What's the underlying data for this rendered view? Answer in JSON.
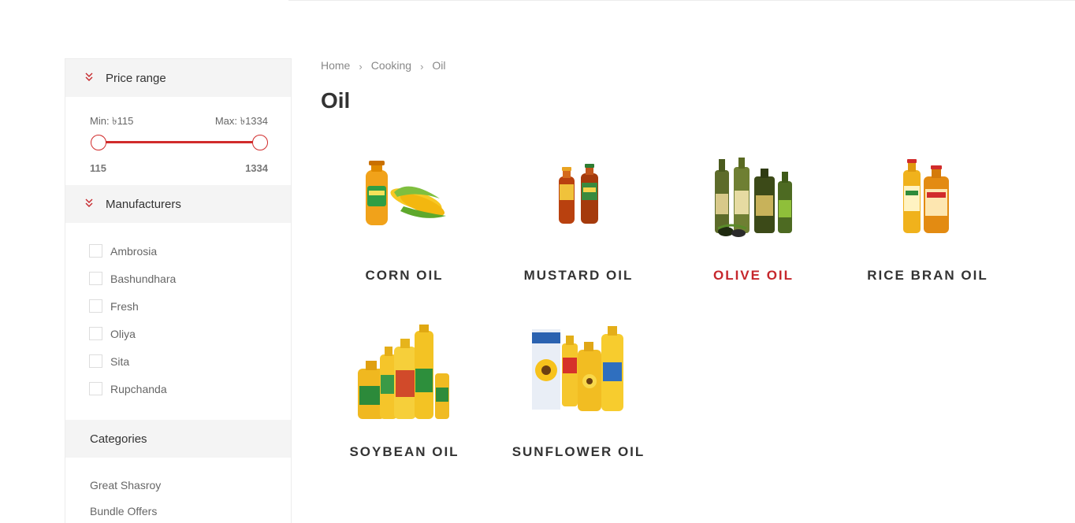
{
  "sidebar": {
    "price": {
      "title": "Price range",
      "min_label": "Min: ৳115",
      "max_label": "Max: ৳1334",
      "range_min": "115",
      "range_max": "1334"
    },
    "manufacturers": {
      "title": "Manufacturers",
      "items": [
        {
          "label": "Ambrosia"
        },
        {
          "label": "Bashundhara"
        },
        {
          "label": "Fresh"
        },
        {
          "label": "Oliya"
        },
        {
          "label": "Sita"
        },
        {
          "label": "Rupchanda"
        }
      ]
    },
    "categories": {
      "title": "Categories",
      "items": [
        {
          "label": "Great Shasroy"
        },
        {
          "label": "Bundle Offers"
        }
      ]
    }
  },
  "breadcrumb": [
    "Home",
    "Cooking",
    "Oil"
  ],
  "page_title": "Oil",
  "products": [
    {
      "name": "CORN OIL",
      "icon": "corn-oil-image"
    },
    {
      "name": "MUSTARD OIL",
      "icon": "mustard-oil-image"
    },
    {
      "name": "OLIVE OIL",
      "icon": "olive-oil-image",
      "highlighted": true
    },
    {
      "name": "RICE BRAN OIL",
      "icon": "rice-bran-oil-image"
    },
    {
      "name": "SOYBEAN OIL",
      "icon": "soybean-oil-image"
    },
    {
      "name": "SUNFLOWER OIL",
      "icon": "sunflower-oil-image"
    }
  ],
  "colors": {
    "accent": "#c6272c",
    "panel_bg": "#f4f4f4"
  }
}
